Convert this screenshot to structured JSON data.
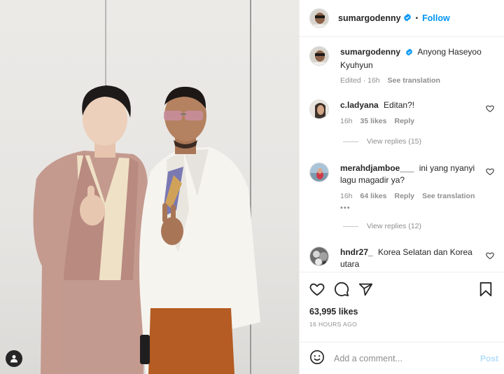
{
  "colors": {
    "accent": "#0095f6",
    "text": "#262626",
    "muted": "#8e8e8e",
    "post_disabled": "#b2dffc",
    "border": "#efefef"
  },
  "header": {
    "username": "sumargodenny",
    "follow_label": "Follow",
    "separator": "•"
  },
  "caption": {
    "username": "sumargodenny",
    "text": "Anyong Haseyoo Kyuhyun",
    "edited": "Edited · 16h",
    "see_translation": "See translation"
  },
  "comments": [
    {
      "username": "c.ladyana",
      "text": "Editan?!",
      "time": "16h",
      "likes": "35 likes",
      "reply": "Reply",
      "view_replies": "View replies (15)"
    },
    {
      "username": "merahdjamboe___",
      "text": "ini yang nyanyi lagu magadir ya?",
      "time": "16h",
      "likes": "64 likes",
      "reply": "Reply",
      "see_translation": "See translation",
      "more": "•••",
      "view_replies": "View replies (12)"
    },
    {
      "username": "hndr27_",
      "text": "Korea Selatan dan Korea utara"
    }
  ],
  "actions": {
    "likes": "63,995 likes",
    "timestamp": "16 HOURS AGO"
  },
  "comment_box": {
    "placeholder": "Add a comment...",
    "post_label": "Post"
  },
  "icons": [
    "verified-badge-icon",
    "heart-icon",
    "comment-icon",
    "share-icon",
    "bookmark-icon",
    "emoji-icon",
    "tagged-people-icon"
  ]
}
